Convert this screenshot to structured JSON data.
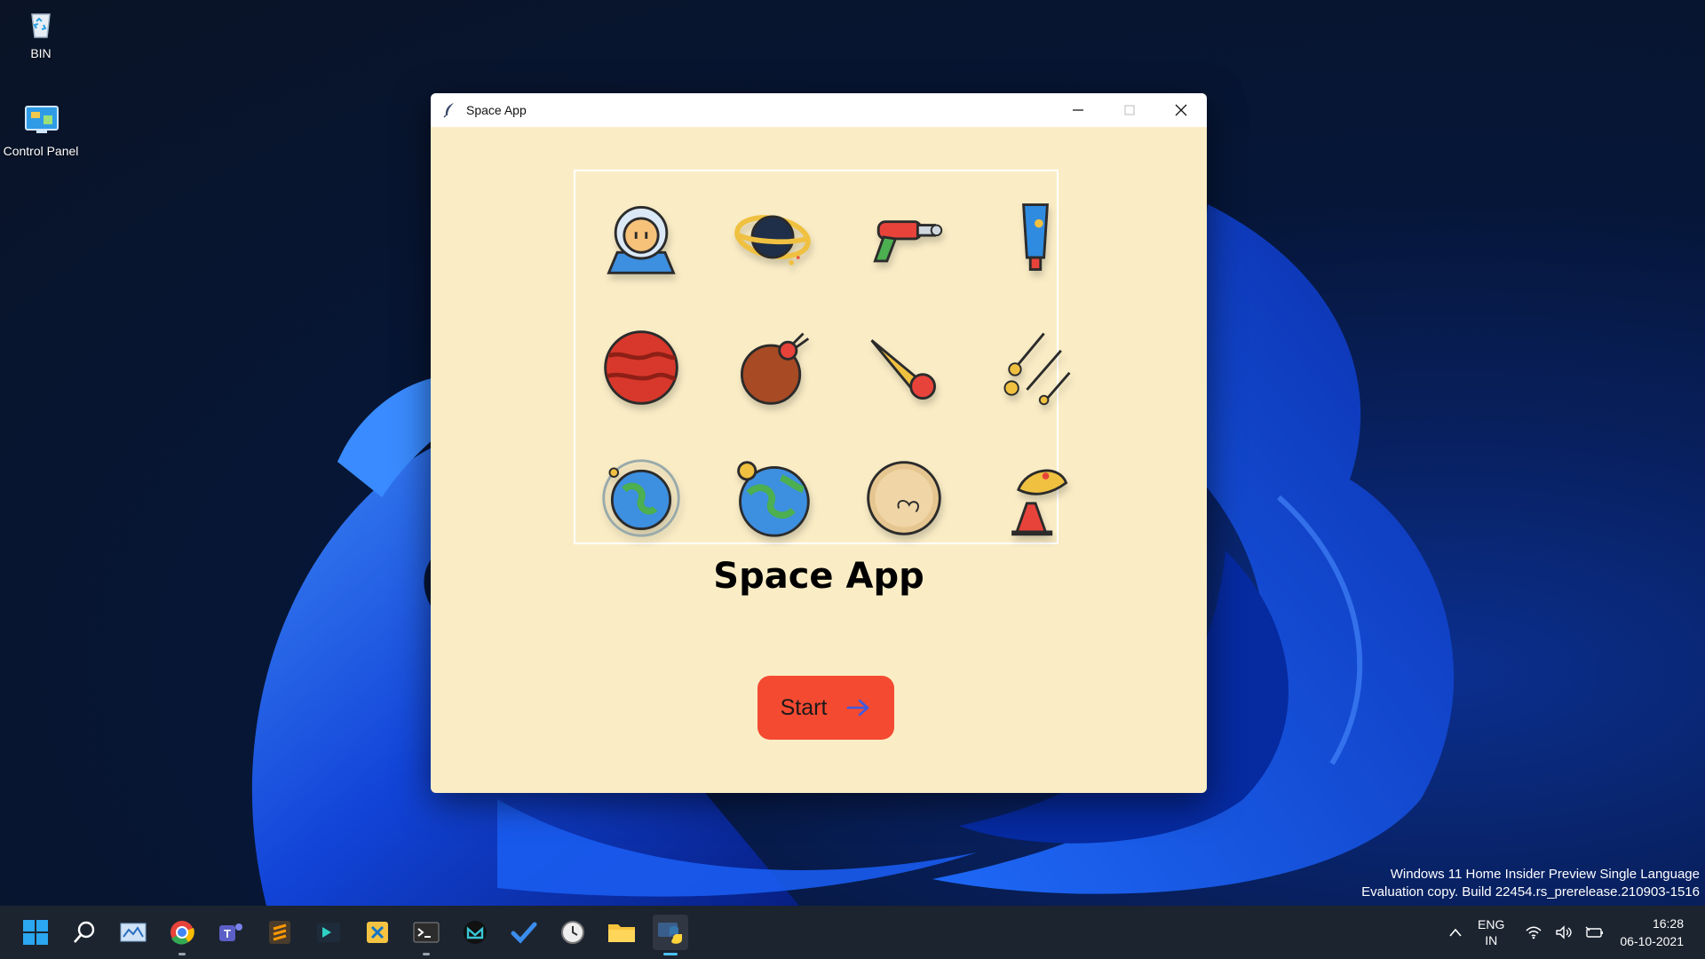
{
  "desktop": {
    "icons": [
      {
        "label": "BIN",
        "icon": "recycle-bin-icon"
      },
      {
        "label": "Control Panel",
        "icon": "control-panel-icon"
      }
    ]
  },
  "window": {
    "title": "Space App",
    "icon": "feather-icon",
    "controls": [
      "minimize-icon",
      "maximize-icon",
      "close-icon"
    ],
    "grid_icons": [
      "astronaut-icon",
      "black-hole-icon",
      "ray-gun-icon",
      "space-food-tube-icon",
      "red-planet-icon",
      "mars-meteor-icon",
      "comet-icon",
      "meteor-shower-icon",
      "earth-orbit-icon",
      "earth-moon-icon",
      "moon-icon",
      "satellite-dish-icon"
    ],
    "heading": "Space App",
    "start_button": {
      "label": "Start",
      "icon": "arrow-right-icon"
    }
  },
  "watermark": {
    "line1": "Windows 11 Home Insider Preview Single Language",
    "line2": "Evaluation copy. Build 22454.rs_prerelease.210903-1516"
  },
  "taskbar": {
    "apps": [
      "start-icon",
      "search-icon",
      "monitor-app-icon",
      "chrome-icon",
      "teams-icon",
      "sublime-icon",
      "powerautomate-icon",
      "snipping-icon",
      "terminal-icon",
      "mail-icon",
      "todo-icon",
      "clock-icon",
      "file-explorer-icon",
      "python-icon"
    ],
    "tray": {
      "lang_top": "ENG",
      "lang_bottom": "IN",
      "time": "16:28",
      "date": "06-10-2021"
    }
  },
  "colors": {
    "window_bg": "#faedc6",
    "start_button": "#f44a31",
    "arrow": "#3f5be0"
  }
}
